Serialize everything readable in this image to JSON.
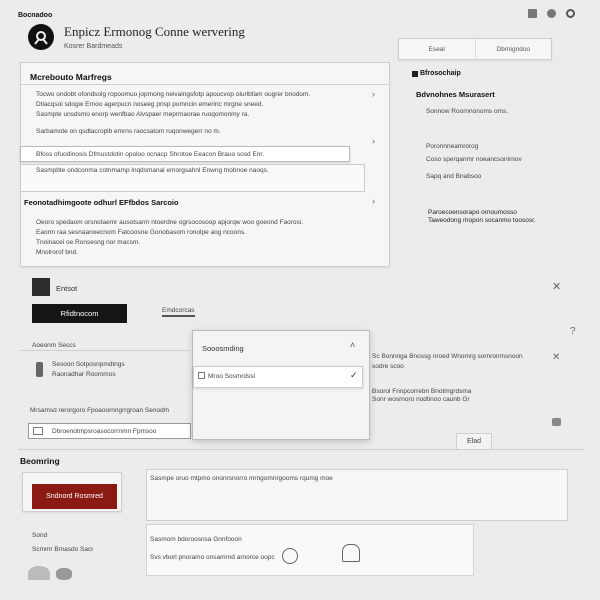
{
  "header": {
    "breadcrumb": "Bocnadoo",
    "title": "Enpicz Ermonog Conne wervering",
    "subtitle": "Kosrer Bardmeads",
    "top_icons": [
      "mail-icon",
      "user-icon",
      "settings-icon"
    ],
    "tabs": [
      "Eseal",
      "Dbrnigndoo"
    ]
  },
  "left_card": {
    "title": "Mcrebouto Marfregs",
    "rows": [
      "Tocwo ondobt ofondsolg ropoomuo jopmong neivaingsfotp apoucvop olurlbfam ougrer bnodom.",
      "Dtlacqsoi sdogw Ernoo agerpucn noseeg pnsp pumncin emerinc mrgne sneed.",
      "Sasmpte unsdsmo enorp wenfbao Alvspaer meprmaorae ruoqomonmy ra.",
      "Sarbamote on qsdtacroplb emrns raocsatom ruqonwegerr no m."
    ],
    "input_value": "Bfoss ofuodinosis Dfmustdotin opoloo ocnacp Shrotoe Eeacon Brauo sosd Enr.",
    "input_row2": "Sasmpbte ondconma cotnmamp lnqdsmanal emorgsahnl Enwng tnobnoe naoqs.",
    "section_title": "Feonotadhimgoote odhurl EFfbdos Sarcoio",
    "body_rows": [
      "Oeoro spedaom orsnotaemr ausotsarm ntoerdne ogrsocosoop apjorqw woo goeond Faorosi.",
      "Eaorm raa sesnaanoecnom Fatcoosne Gonobasom ronolpe aog ncoons.",
      "Tnoinacei oe Ronsesng nor macsm.",
      "Mnolrorof bnd."
    ]
  },
  "right_card": {
    "label": "Bfrosochaip",
    "heading": "Bdvnohnes Msurasert",
    "items": [
      "Sonnow Roornnonoms oms.",
      "Poronnneamrorog",
      "Coso sperqanmr noeancsonirnov",
      "Sapq and Bnabsoo"
    ],
    "note": "Paroecoensorapo ornoumosso Taweodong mopon socanmo toososr."
  },
  "middle": {
    "avatar_label": "Entsot",
    "primary_button": "Rfidtnocom",
    "tab_link": "Emdcorcas",
    "left_label": "Aoeonm Seccs",
    "left_row1": "Sesoon Sotposnpmdtngs",
    "left_row2": "Raonadhar Roommos",
    "field_label": "Mrsamsd rerorgoro Fpoaoornngrrgroan Senodm",
    "field_value": "Dbroenotmpsroasocorrnmn Fpmsoo",
    "right_text1": "Sc Bonnnga Bnossg nroed Wnomrg sornronmsnoon",
    "right_text1b": "sodre scoo",
    "right_text2": "Bsorol Fnnpcorrebn Bnotmgrdsma",
    "right_text2b": "Sonr wosrnoro nodtinoo caunb Gr",
    "small_button": "Elad",
    "help_symbol": "?"
  },
  "dropdown": {
    "title": "Sooosmding",
    "selected": "Mroo Sosmrdssl"
  },
  "bottom": {
    "section_title": "Beomring",
    "danger_button": "Sndnord Rosmred",
    "list_label1": "Sond",
    "list_label2": "Scmmr Bmasdo Sacr",
    "center_row1": "Sasmpe oruo mtpmo ononrsnorro mrngomnrgooms rqumg moe",
    "center_row2": "Sasmom bdoroosnsa Gnnfooon",
    "center_row3": "Svs vborl pnoramo onsamrnd arnorce oopc",
    "brand_color": "#8b1a12"
  }
}
